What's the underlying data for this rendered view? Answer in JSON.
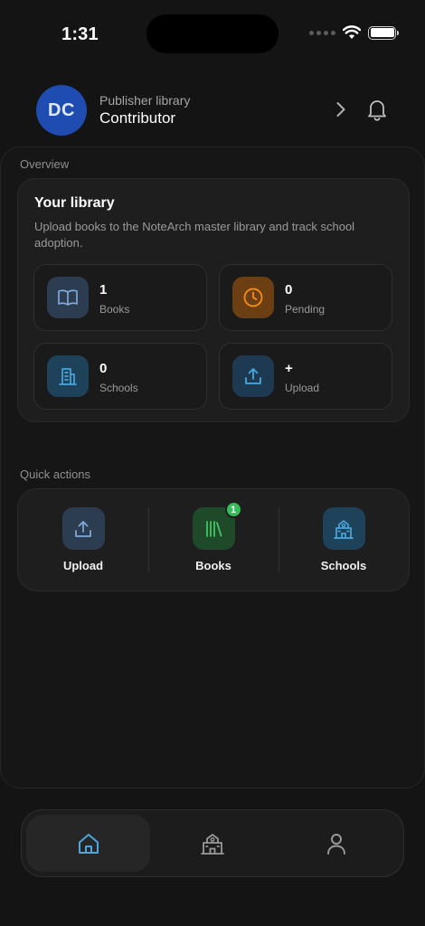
{
  "status_bar": {
    "time": "1:31"
  },
  "header": {
    "avatar_initials": "DC",
    "subtitle": "Publisher library",
    "title": "Contributor",
    "chevron_icon": "chevron-right-icon",
    "bell_icon": "bell-icon"
  },
  "overview": {
    "section_label": "Overview",
    "card_title": "Your library",
    "card_description": "Upload books to the NoteArch master library and track school adoption.",
    "stats": [
      {
        "value": "1",
        "label": "Books",
        "icon": "book-open-icon",
        "bg": "#2c3d52",
        "fg": "#7fa9d6"
      },
      {
        "value": "0",
        "label": "Pending",
        "icon": "clock-icon",
        "bg": "#6b3f12",
        "fg": "#f08a1c"
      },
      {
        "value": "0",
        "label": "Schools",
        "icon": "building-icon",
        "bg": "#1d4259",
        "fg": "#4aa6dd"
      },
      {
        "value": "+",
        "label": "Upload",
        "icon": "upload-icon",
        "bg": "#1d3a52",
        "fg": "#4aa6dd"
      }
    ]
  },
  "quick_actions": {
    "section_label": "Quick actions",
    "items": [
      {
        "label": "Upload",
        "icon": "upload-icon",
        "bg": "#2c3d52",
        "fg": "#7fa9d6"
      },
      {
        "label": "Books",
        "icon": "books-icon",
        "bg": "#1f4a2a",
        "fg": "#43c463",
        "badge": "1"
      },
      {
        "label": "Schools",
        "icon": "school-icon",
        "bg": "#1d4259",
        "fg": "#4aa6dd"
      }
    ]
  },
  "bottom_nav": {
    "items": [
      {
        "icon": "home-icon",
        "active": true
      },
      {
        "icon": "school-icon",
        "active": false
      },
      {
        "icon": "person-icon",
        "active": false
      }
    ]
  },
  "colors": {
    "background": "#141414",
    "accent": "#4aa6dd",
    "badge": "#2fbf56"
  }
}
